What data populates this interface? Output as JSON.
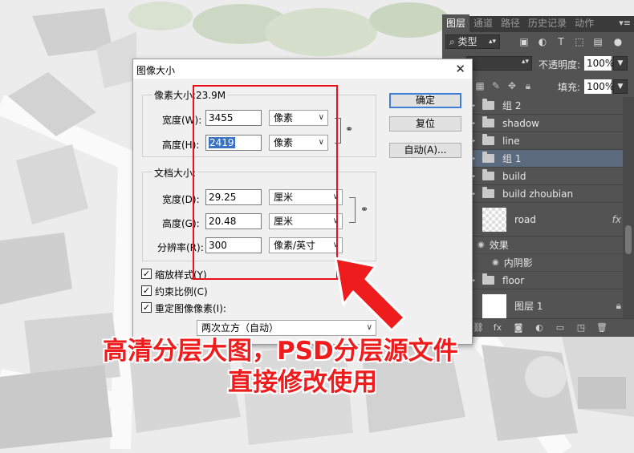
{
  "layers_panel": {
    "tabs": [
      "图层",
      "通道",
      "路径",
      "历史记录",
      "动作"
    ],
    "kind_filter": "类型",
    "opacity_label": "不透明度:",
    "opacity_value": "100%",
    "fill_label": "填充:",
    "fill_value": "100%",
    "layers": [
      {
        "name": "组 2",
        "type": "group"
      },
      {
        "name": "shadow",
        "type": "group"
      },
      {
        "name": "line",
        "type": "group"
      },
      {
        "name": "组 1",
        "type": "group",
        "selected": true
      },
      {
        "name": "build",
        "type": "group"
      },
      {
        "name": "build zhoubian",
        "type": "group"
      },
      {
        "name": "road",
        "type": "layer",
        "fx": "fx"
      },
      {
        "name": "效果",
        "type": "effect"
      },
      {
        "name": "内阴影",
        "type": "effect"
      },
      {
        "name": "floor",
        "type": "group"
      },
      {
        "name": "图层 1",
        "type": "layer",
        "locked": true
      }
    ]
  },
  "dialog": {
    "title": "图像大小",
    "pixel_dimensions": {
      "label": "像素大小:23.9M",
      "width_label": "宽度(W):",
      "width_value": "3455",
      "width_unit": "像素",
      "height_label": "高度(H):",
      "height_value": "2419",
      "height_unit": "像素"
    },
    "document_size": {
      "label": "文档大小:",
      "width_label": "宽度(D):",
      "width_value": "29.25",
      "width_unit": "厘米",
      "height_label": "高度(G):",
      "height_value": "20.48",
      "height_unit": "厘米",
      "resolution_label": "分辨率(R):",
      "resolution_value": "300",
      "resolution_unit": "像素/英寸"
    },
    "buttons": {
      "ok": "确定",
      "reset": "复位",
      "auto": "自动(A)..."
    },
    "checkboxes": {
      "scale_styles": "缩放样式(Y)",
      "constrain": "约束比例(C)",
      "resample": "重定图像像素(I):"
    },
    "resample_method": "两次立方（自动）"
  },
  "promo": {
    "line1": "高清分层大图，PSD分层源文件",
    "line2": "直接修改使用",
    "color": "#ee1c1c"
  }
}
